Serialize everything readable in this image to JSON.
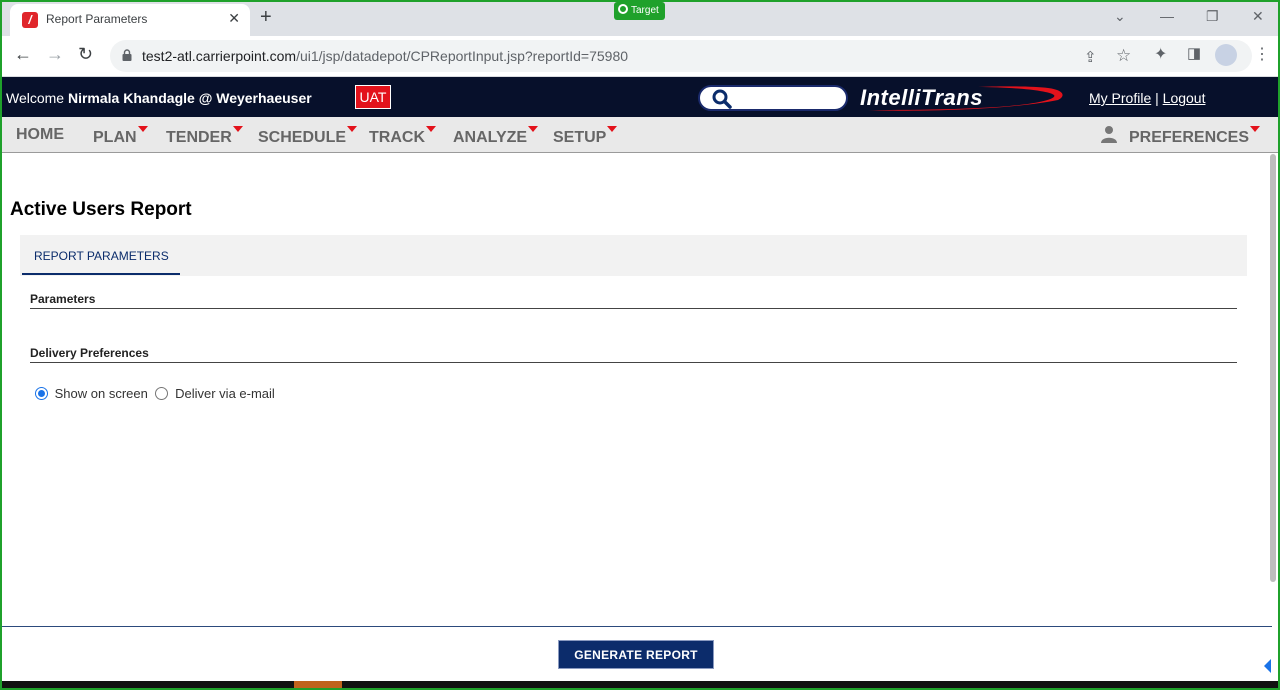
{
  "browser": {
    "tab_title": "Report Parameters",
    "tab_close": "✕",
    "new_tab": "+",
    "target_badge": "Target",
    "url_host": "test2-atl.carrierpoint.com",
    "url_path": "/ui1/jsp/datadepot/CPReportInput.jsp?reportId=75980",
    "window_controls": [
      "⌄",
      "—",
      "❐",
      "✕"
    ]
  },
  "header": {
    "welcome_prefix": "Welcome ",
    "user": "Nirmala Khandagle @ Weyerhaeuser",
    "env_badge": "UAT",
    "logo_text": "IntelliTrans",
    "my_profile": "My Profile",
    "separator": " | ",
    "logout": "Logout"
  },
  "nav": {
    "home": "HOME",
    "plan": "PLAN",
    "tender": "TENDER",
    "schedule": "SCHEDULE",
    "track": "TRACK",
    "analyze": "ANALYZE",
    "setup": "SETUP",
    "preferences": "PREFERENCES"
  },
  "page": {
    "title": "Active Users Report",
    "tab": "REPORT PARAMETERS",
    "section_parameters": "Parameters",
    "section_delivery": "Delivery Preferences",
    "radio_screen": "Show on screen",
    "radio_email": "Deliver via e-mail",
    "radio_selected": "Show on screen",
    "generate_button": "GENERATE REPORT"
  },
  "colors": {
    "header_bg": "#07102b",
    "accent_red": "#e3121b",
    "primary_blue": "#0c2c6b",
    "frame_green": "#1fa12b"
  }
}
